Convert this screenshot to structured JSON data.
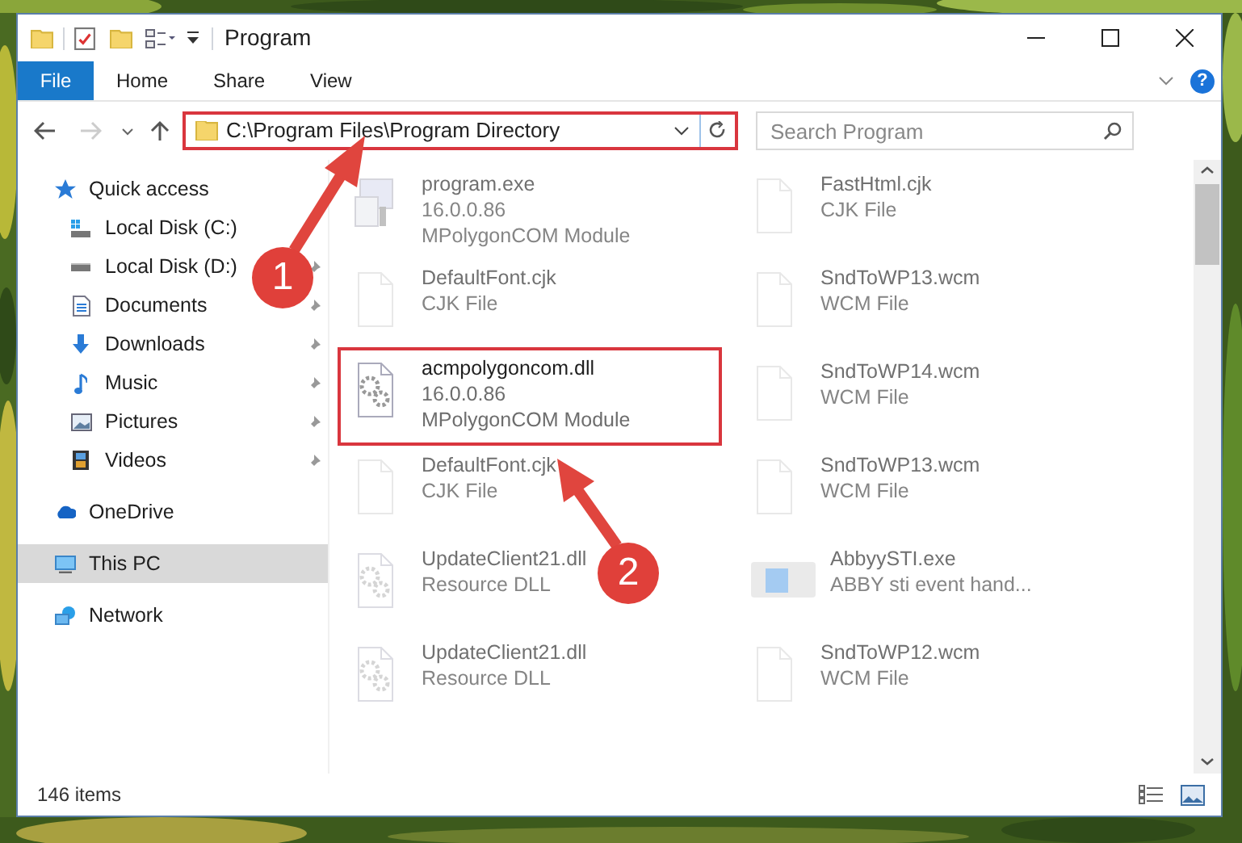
{
  "window": {
    "title": "Program"
  },
  "ribbon_tabs": [
    {
      "label": "File",
      "kind": "file"
    },
    {
      "label": "Home",
      "kind": "tab"
    },
    {
      "label": "Share",
      "kind": "tab"
    },
    {
      "label": "View",
      "kind": "tab"
    }
  ],
  "help_button": "?",
  "address_bar": {
    "path": "C:\\Program Files\\Program Directory"
  },
  "search": {
    "placeholder": "Search Program"
  },
  "navigation": [
    {
      "label": "Quick access",
      "kind": "star",
      "selected": false,
      "children": [
        {
          "label": "Local Disk (C:)",
          "kind": "system-drive",
          "pinned": false,
          "selected": false
        },
        {
          "label": "Local Disk (D:)",
          "kind": "drive",
          "pinned": true,
          "selected": false
        },
        {
          "label": "Documents",
          "kind": "document",
          "pinned": true,
          "selected": false
        },
        {
          "label": "Downloads",
          "kind": "download",
          "pinned": true,
          "selected": false
        },
        {
          "label": "Music",
          "kind": "music",
          "pinned": true,
          "selected": false
        },
        {
          "label": "Pictures",
          "kind": "pictures",
          "pinned": true,
          "selected": false
        },
        {
          "label": "Videos",
          "kind": "videos",
          "pinned": true,
          "selected": false
        }
      ]
    },
    {
      "label": "OneDrive",
      "kind": "cloud",
      "selected": false
    },
    {
      "label": "This PC",
      "kind": "pc",
      "selected": true
    },
    {
      "label": "Network",
      "kind": "network",
      "selected": false
    }
  ],
  "files": [
    {
      "name": "program.exe",
      "details": [
        "16.0.0.86",
        "MPolygonCOM Module"
      ],
      "kind": "exe",
      "dimmed": true,
      "highlighted": false
    },
    {
      "name": "FastHtml.cjk",
      "details": [
        "CJK File"
      ],
      "kind": "generic",
      "dimmed": true,
      "highlighted": false
    },
    {
      "name": "DefaultFont.cjk",
      "details": [
        "CJK File"
      ],
      "kind": "generic",
      "dimmed": true,
      "highlighted": false
    },
    {
      "name": "SndToWP13.wcm",
      "details": [
        "WCM File"
      ],
      "kind": "generic",
      "dimmed": true,
      "highlighted": false
    },
    {
      "name": "acmpolygoncom.dll",
      "details": [
        "16.0.0.86",
        "MPolygonCOM Module"
      ],
      "kind": "gears",
      "dimmed": false,
      "highlighted": true
    },
    {
      "name": "SndToWP14.wcm",
      "details": [
        "WCM File"
      ],
      "kind": "generic",
      "dimmed": true,
      "highlighted": false
    },
    {
      "name": "DefaultFont.cjk",
      "details": [
        "CJK File"
      ],
      "kind": "generic",
      "dimmed": true,
      "highlighted": false
    },
    {
      "name": "SndToWP13.wcm",
      "details": [
        "WCM File"
      ],
      "kind": "generic",
      "dimmed": true,
      "highlighted": false
    },
    {
      "name": "UpdateClient21.dll",
      "details": [
        "Resource DLL"
      ],
      "kind": "gears",
      "dimmed": true,
      "highlighted": false
    },
    {
      "name": "AbbyySTI.exe",
      "details": [
        "ABBY sti event hand..."
      ],
      "kind": "app",
      "dimmed": true,
      "highlighted": false
    },
    {
      "name": "UpdateClient21.dll",
      "details": [
        "Resource DLL"
      ],
      "kind": "gears",
      "dimmed": true,
      "highlighted": false
    },
    {
      "name": "SndToWP12.wcm",
      "details": [
        "WCM File"
      ],
      "kind": "generic",
      "dimmed": true,
      "highlighted": false
    }
  ],
  "status_bar": {
    "item_count": "146 items"
  },
  "annotations": [
    {
      "number": "1"
    },
    {
      "number": "2"
    }
  ]
}
